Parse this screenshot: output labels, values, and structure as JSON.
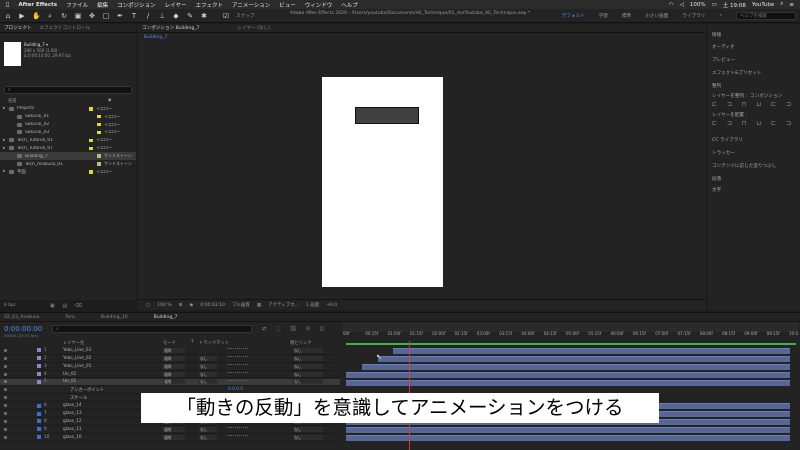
{
  "menubar": {
    "app": "After Effects",
    "items": [
      "ファイル",
      "編集",
      "コンポジション",
      "レイヤー",
      "エフェクト",
      "アニメーション",
      "ビュー",
      "ウィンドウ",
      "ヘルプ"
    ],
    "battery": "100%",
    "clock": "土 19:08",
    "user": "YouTube"
  },
  "window": {
    "title": "Adobe After Effects 2020 - /Users/youtube/Documents/AE_Technique/01_Ae/Youtube_AE_Technique.aep *",
    "snap_label": "スナップ",
    "workspaces": [
      "デフォルト",
      "学習",
      "標準",
      "小さい画面",
      "ライブラリ"
    ],
    "help_search": "ヘルプを検索"
  },
  "project": {
    "tabs": [
      "プロジェクト",
      "エフェクトコントロール"
    ],
    "comp_name": "Building_7 ▾",
    "info_lines": [
      "286 x 500 (1.00)",
      "Δ 0:00:10:00, 29.97 fps"
    ],
    "col_name": "名前",
    "items": [
      {
        "name": "Projects",
        "label": "イエロー",
        "indent": 0
      },
      {
        "name": "Sakurai_01",
        "label": "イエロー",
        "indent": 1
      },
      {
        "name": "Sakurai_02",
        "label": "イエロー",
        "indent": 1
      },
      {
        "name": "Sakurai_03",
        "label": "イエロー",
        "indent": 1
      },
      {
        "name": "Tech_Tutorial_01",
        "label": "イエロー",
        "indent": 0
      },
      {
        "name": "Tech_Tutorial_07",
        "label": "イエロー",
        "indent": 0
      },
      {
        "name": "Building_7",
        "label": "サンドストーン",
        "indent": 1
      },
      {
        "name": "Tech_Asakusa_01",
        "label": "サンドストーン",
        "indent": 1
      },
      {
        "name": "平面",
        "label": "イエロー",
        "indent": 0
      }
    ],
    "footer_bpc": "8 bpc"
  },
  "viewer": {
    "tabs": [
      "コンポジション Building_7",
      "レイヤー (なし)"
    ],
    "breadcrumb": "Building_7",
    "footer": [
      "100 %",
      "0:00:03:10",
      "フル画質",
      "アクティブカ...",
      "1 画面",
      "+0.0"
    ]
  },
  "right_panel": {
    "items": [
      "情報",
      "オーディオ",
      "プレビュー",
      "エフェクト&プリセット",
      "整列",
      "レイヤーを整列 :",
      "コンポジション",
      "レイヤーを配置 :",
      "CC ライブラリ",
      "トラッカー",
      "コンテンツに応じた塗りつぶし",
      "段落",
      "文字"
    ]
  },
  "timeline": {
    "tabs": [
      "02_03_Asakusa",
      "Tera",
      "Building_10",
      "Building_7"
    ],
    "timecode": "0:00:00:00",
    "fps_note": "00000 (29.97 fps)",
    "columns": [
      "レイヤー名",
      "モード",
      "T",
      "トラックマット",
      "親とリンク"
    ],
    "ruler": [
      "00f",
      "00:15f",
      "01:00f",
      "01:15f",
      "02:00f",
      "02:15f",
      "03:00f",
      "03:15f",
      "04:00f",
      "04:15f",
      "05:00f",
      "05:15f",
      "06:00f",
      "06:15f",
      "07:00f",
      "07:15f",
      "08:00f",
      "08:15f",
      "09:00f",
      "09:15f",
      "10:0"
    ],
    "layers": [
      {
        "num": "1",
        "name": "Yoko_Line_03",
        "mode": "通常",
        "matte": "",
        "parent": "なし",
        "label": "#9c7fcf"
      },
      {
        "num": "2",
        "name": "Yoko_Line_02",
        "mode": "通常",
        "matte": "なし",
        "parent": "なし",
        "label": "#9c7fcf"
      },
      {
        "num": "3",
        "name": "Yoko_Line_01",
        "mode": "通常",
        "matte": "なし",
        "parent": "なし",
        "label": "#9c7fcf"
      },
      {
        "num": "4",
        "name": "Ue_02",
        "mode": "通常",
        "matte": "なし",
        "parent": "なし",
        "label": "#9c7fcf"
      },
      {
        "num": "5",
        "name": "Ue_01",
        "mode": "通常",
        "matte": "なし",
        "parent": "なし",
        "label": "#9c7fcf"
      },
      {
        "num": "",
        "name": "アンカーポイント",
        "mode": "",
        "matte": "",
        "parent": "",
        "label": ""
      },
      {
        "num": "",
        "name": "スケール",
        "mode": "",
        "matte": "",
        "parent": "",
        "label": ""
      },
      {
        "num": "6",
        "name": "glass_14",
        "mode": "通常",
        "matte": "なし",
        "parent": "なし",
        "label": "#3c6fd6"
      },
      {
        "num": "7",
        "name": "glass_13",
        "mode": "通常",
        "matte": "なし",
        "parent": "なし",
        "label": "#3c6fd6"
      },
      {
        "num": "8",
        "name": "glass_12",
        "mode": "通常",
        "matte": "なし",
        "parent": "なし",
        "label": "#3c6fd6"
      },
      {
        "num": "9",
        "name": "glass_11",
        "mode": "通常",
        "matte": "なし",
        "parent": "なし",
        "label": "#3c6fd6"
      },
      {
        "num": "10",
        "name": "glass_10",
        "mode": "通常",
        "matte": "なし",
        "parent": "なし",
        "label": "#3c6fd6"
      }
    ],
    "anchor_value": "0.0,0.0",
    "scale_value": "0.0,0.0 %"
  },
  "subtitle": "「動きの反動」を意識してアニメーションをつける",
  "colors": {
    "accent": "#4a8ff5",
    "label_yellow": "#e4d33a",
    "layer_bar": "#566695",
    "playhead": "#d43b3b"
  }
}
